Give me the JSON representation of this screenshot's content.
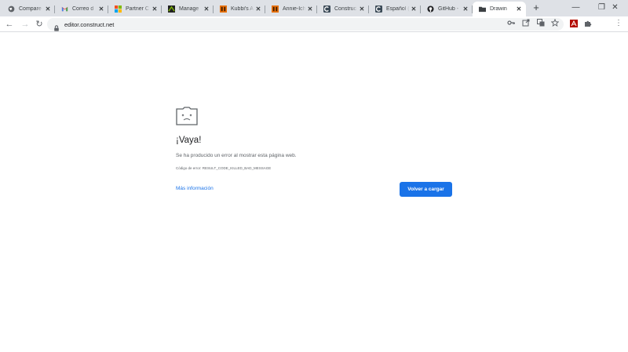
{
  "tabs": [
    {
      "title": "Compare",
      "icon": "globe-icon"
    },
    {
      "title": "Correo d",
      "icon": "gmail-icon"
    },
    {
      "title": "Partner C",
      "icon": "microsoft-icon"
    },
    {
      "title": "Manage",
      "icon": "manage-app-icon"
    },
    {
      "title": "Kubbi's A",
      "icon": "orange-game-icon"
    },
    {
      "title": "Annie-Ich",
      "icon": "orange-game-icon"
    },
    {
      "title": "Construc",
      "icon": "construct-icon"
    },
    {
      "title": "Español (",
      "icon": "construct-icon"
    },
    {
      "title": "GitHub -",
      "icon": "github-icon"
    },
    {
      "title": "Drawin",
      "icon": "folder-icon"
    }
  ],
  "new_tab_label": "+",
  "window_controls": {
    "minimize": "—",
    "restore": "❐",
    "close": "✕"
  },
  "toolbar": {
    "back": "←",
    "forward": "→",
    "reload": "↻",
    "url": "editor.construct.net"
  },
  "error": {
    "title": "¡Vaya!",
    "message": "Se ha producido un error al mostrar esta página web.",
    "code": "Código de error: RESULT_CODE_KILLED_BAD_MESSAGE",
    "more_info": "Más información",
    "reload_button": "Volver a cargar"
  },
  "colors": {
    "accent": "#1a73e8",
    "tabstrip": "#dee1e6"
  }
}
